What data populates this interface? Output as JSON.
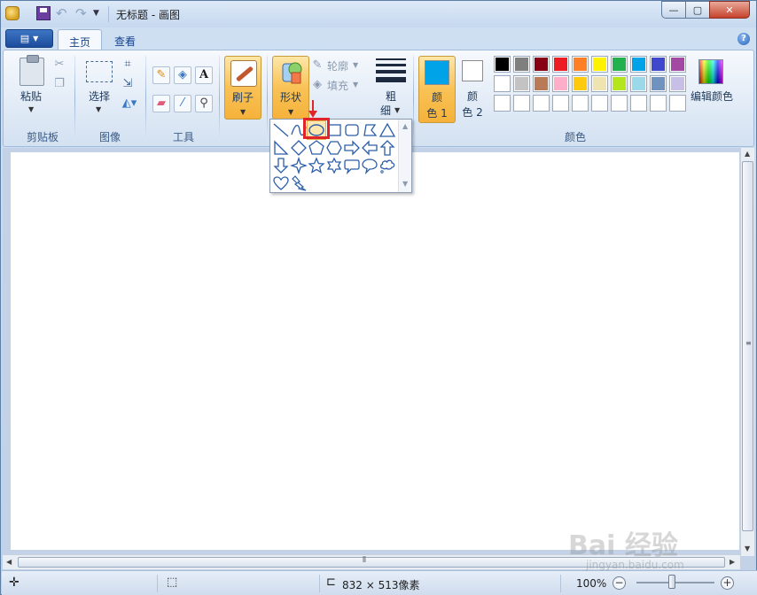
{
  "window": {
    "title": "无标题 - 画图",
    "controls": {
      "minimize": "—",
      "maximize": "▢",
      "close": "✕"
    }
  },
  "quick_access": {
    "icons": [
      "paint-app-icon",
      "save-icon",
      "undo-icon",
      "redo-icon",
      "customize-dropdown-icon"
    ]
  },
  "tabs": {
    "menu_icon": "▤",
    "home": "主页",
    "view": "查看",
    "help": "?"
  },
  "ribbon": {
    "clipboard": {
      "paste": "粘贴",
      "group": "剪贴板"
    },
    "image": {
      "select": "选择",
      "group": "图像"
    },
    "tools": {
      "group": "工具",
      "text_tool": "A"
    },
    "brushes": {
      "label": "刷子"
    },
    "shapes": {
      "label": "形状",
      "outline": "轮廓",
      "fill": "填充"
    },
    "size": {
      "label1": "粗",
      "label2": "细"
    },
    "colors": {
      "color1_a": "颜",
      "color1_b": "色 1",
      "color2_a": "颜",
      "color2_b": "色 2",
      "color1_value": "#00a2e8",
      "color2_value": "#ffffff",
      "edit": "编辑颜色",
      "group": "颜色",
      "palette_row1": [
        "#000000",
        "#7f7f7f",
        "#880015",
        "#ed1c24",
        "#ff7f27",
        "#fff200",
        "#22b14c",
        "#00a2e8",
        "#3f48cc",
        "#a349a4"
      ],
      "palette_row2": [
        "#ffffff",
        "#c3c3c3",
        "#b97a57",
        "#ffaec9",
        "#ffc90e",
        "#efe4b0",
        "#b5e61d",
        "#99d9ea",
        "#7092be",
        "#c8bfe7"
      ]
    }
  },
  "shapes_dropdown": {
    "selected": "oval",
    "items": [
      "line",
      "curve",
      "oval",
      "rectangle",
      "rounded-rectangle",
      "polygon",
      "triangle",
      "right-triangle",
      "diamond",
      "pentagon",
      "hexagon",
      "right-arrow",
      "left-arrow",
      "up-arrow",
      "down-arrow",
      "four-point-star",
      "five-point-star",
      "six-point-star",
      "rounded-callout",
      "oval-callout",
      "cloud-callout",
      "heart",
      "lightning"
    ]
  },
  "status": {
    "canvas_size": "832 × 513像素",
    "zoom": "100%"
  },
  "watermark": {
    "main": "Bai 经验",
    "sub": "jingyan.baidu.com"
  }
}
